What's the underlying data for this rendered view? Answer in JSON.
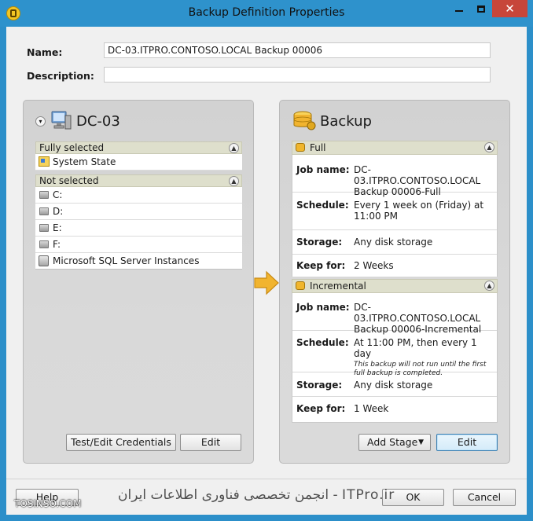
{
  "window": {
    "title": "Backup Definition Properties",
    "controls": {
      "minimize": "minimize-icon",
      "maximize": "maximize-icon",
      "close": "✕"
    }
  },
  "form": {
    "name_label": "Name:",
    "name_value": "DC-03.ITPRO.CONTOSO.LOCAL Backup 00006",
    "description_label": "Description:",
    "description_value": ""
  },
  "source": {
    "title": "DC-03",
    "fully_selected": {
      "header": "Fully selected",
      "items": [
        "System State"
      ]
    },
    "not_selected": {
      "header": "Not selected",
      "items": [
        "C:",
        "D:",
        "E:",
        "F:",
        "Microsoft SQL Server Instances"
      ]
    },
    "buttons": {
      "credentials": "Test/Edit Credentials",
      "edit": "Edit"
    }
  },
  "backup": {
    "title": "Backup",
    "stages": [
      {
        "name": "Full",
        "rows": [
          {
            "key": "Job name:",
            "value": "DC-03.ITPRO.CONTOSO.LOCAL Backup 00006-Full",
            "note": ""
          },
          {
            "key": "Schedule:",
            "value": "Every 1 week on (Friday) at 11:00 PM",
            "note": ""
          },
          {
            "key": "Storage:",
            "value": "Any disk storage",
            "note": ""
          },
          {
            "key": "Keep for:",
            "value": "2 Weeks",
            "note": ""
          }
        ]
      },
      {
        "name": "Incremental",
        "rows": [
          {
            "key": "Job name:",
            "value": "DC-03.ITPRO.CONTOSO.LOCAL Backup 00006-Incremental",
            "note": ""
          },
          {
            "key": "Schedule:",
            "value": "At 11:00 PM, then every 1 day",
            "note": "This backup will not run until the first full backup is completed."
          },
          {
            "key": "Storage:",
            "value": "Any disk storage",
            "note": ""
          },
          {
            "key": "Keep for:",
            "value": "1 Week",
            "note": ""
          }
        ]
      }
    ],
    "buttons": {
      "add_stage": "Add Stage",
      "edit": "Edit"
    }
  },
  "footer": {
    "help": "Help",
    "ok": "OK",
    "cancel": "Cancel"
  },
  "watermark": {
    "main": "انجمن تخصصی فناوری اطلاعات ایران - ITPro.ir",
    "site": "TOSINSO.COM"
  },
  "colors": {
    "titlebar": "#2e92cc",
    "close": "#c7463a",
    "group_header": "#dedfcc",
    "arrow": "#f1b42f"
  }
}
